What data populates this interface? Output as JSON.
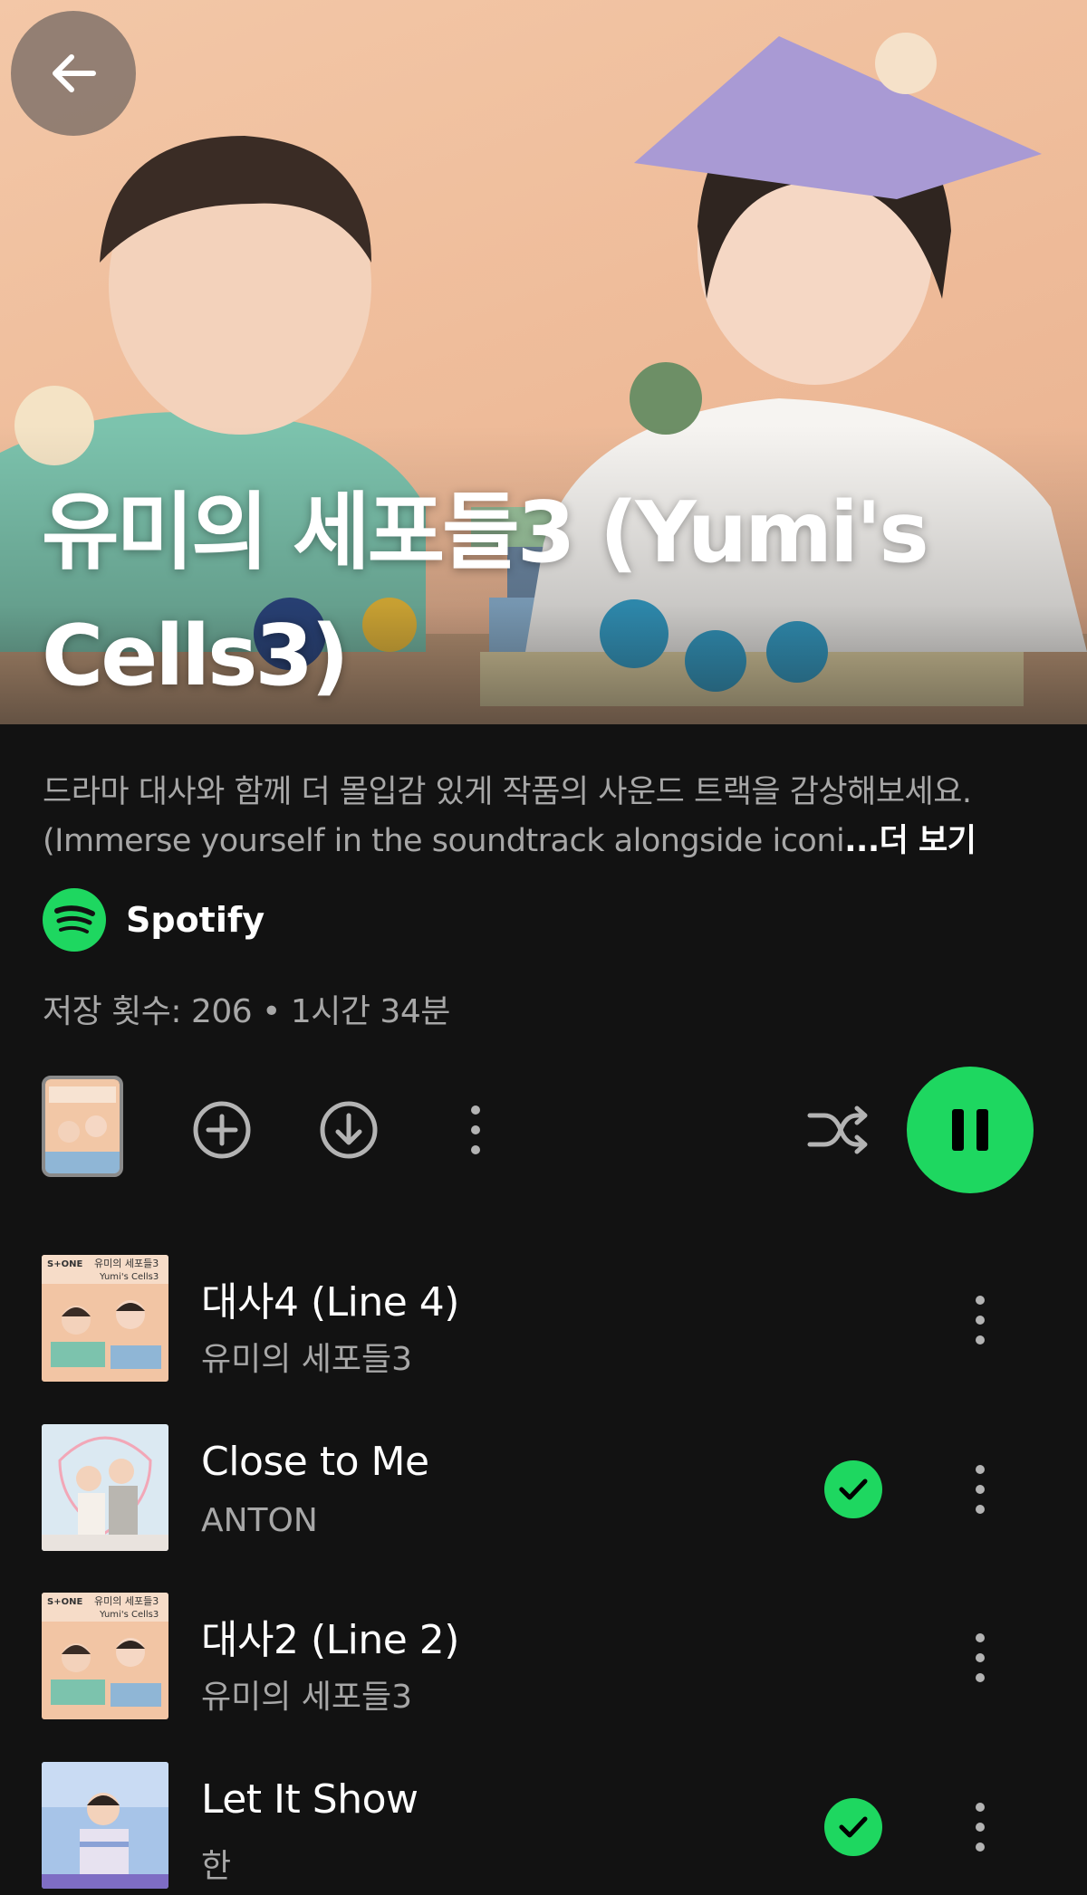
{
  "playlist": {
    "title": "유미의 세포들3 (Yumi's Cells3)",
    "description_line1": "드라마 대사와 함께 더 몰입감 있게 작품의 사운드 트랙을 감상해보세요.",
    "description_line2": "(Immerse yourself in the soundtrack alongside iconi",
    "more_label": "...더 보기",
    "owner": "Spotify",
    "stats": "저장 횟수: 206 • 1시간 34분"
  },
  "cover_text": {
    "label": "S+ONE",
    "title_kr": "유미의 세포들3",
    "title_en": "Yumi's Cells3"
  },
  "colors": {
    "background": "#121212",
    "accent": "#1ed760",
    "secondary_text": "#a7a7a7"
  },
  "icons": {
    "back": "arrow-left-icon",
    "add": "add-circle-icon",
    "download": "download-icon",
    "more": "more-vertical-icon",
    "shuffle": "shuffle-icon",
    "pause": "pause-icon",
    "downloaded": "check-icon"
  },
  "tracks": [
    {
      "title": "대사4 (Line 4)",
      "artist": "유미의 세포들3",
      "downloaded": false
    },
    {
      "title": "Close to Me",
      "artist": "ANTON",
      "downloaded": true
    },
    {
      "title": "대사2 (Line 2)",
      "artist": "유미의 세포들3",
      "downloaded": false
    },
    {
      "title": "Let It Show",
      "artist": "한",
      "downloaded": true
    }
  ]
}
